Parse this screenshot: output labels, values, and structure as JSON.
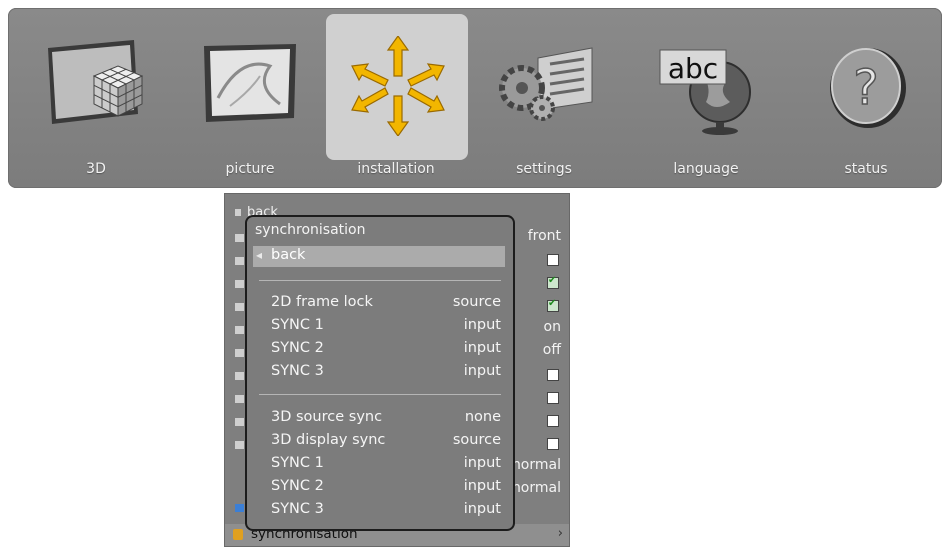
{
  "menubar": {
    "items": [
      {
        "label": "3D",
        "icon": "rubiks-cube-icon"
      },
      {
        "label": "picture",
        "icon": "picture-frame-icon"
      },
      {
        "label": "installation",
        "icon": "installation-arrows-icon",
        "selected": true
      },
      {
        "label": "settings",
        "icon": "gears-settings-icon"
      },
      {
        "label": "language",
        "icon": "abc-globe-icon",
        "icon_text": "abc"
      },
      {
        "label": "status",
        "icon": "question-mark-icon",
        "icon_text": "?"
      }
    ]
  },
  "under_menu": {
    "back_label": "back",
    "visible_values": [
      "front",
      "on",
      "off",
      "normal",
      "normal"
    ],
    "value_rows": [
      {
        "value": "front",
        "type": "text"
      },
      {
        "type": "checkbox",
        "checked": false
      },
      {
        "type": "checkbox",
        "checked": true
      },
      {
        "type": "checkbox",
        "checked": true
      },
      {
        "value": "on",
        "type": "text"
      },
      {
        "value": "off",
        "type": "text"
      },
      {
        "type": "checkbox",
        "checked": false
      },
      {
        "type": "checkbox",
        "checked": false
      },
      {
        "type": "checkbox",
        "checked": false
      },
      {
        "type": "checkbox",
        "checked": false
      },
      {
        "value": "normal",
        "type": "text"
      },
      {
        "value": "normal",
        "type": "text"
      }
    ],
    "bottom_item": "synchronisation"
  },
  "sync_menu": {
    "title": "synchronisation",
    "back_label": "back",
    "group1": [
      {
        "label": "2D frame lock",
        "value": "source"
      },
      {
        "label": "SYNC 1",
        "value": "input"
      },
      {
        "label": "SYNC 2",
        "value": "input"
      },
      {
        "label": "SYNC 3",
        "value": "input"
      }
    ],
    "group2": [
      {
        "label": "3D source sync",
        "value": "none"
      },
      {
        "label": "3D display sync",
        "value": "source"
      },
      {
        "label": "SYNC 1",
        "value": "input"
      },
      {
        "label": "SYNC 2",
        "value": "input"
      },
      {
        "label": "SYNC 3",
        "value": "input"
      }
    ]
  },
  "colors": {
    "menubar_bg": "#808080",
    "selected_bg": "#d0d0d0",
    "panel_bg": "#7c7c7c",
    "highlight_row": "#ababab",
    "accent_yellow": "#f2b600"
  }
}
